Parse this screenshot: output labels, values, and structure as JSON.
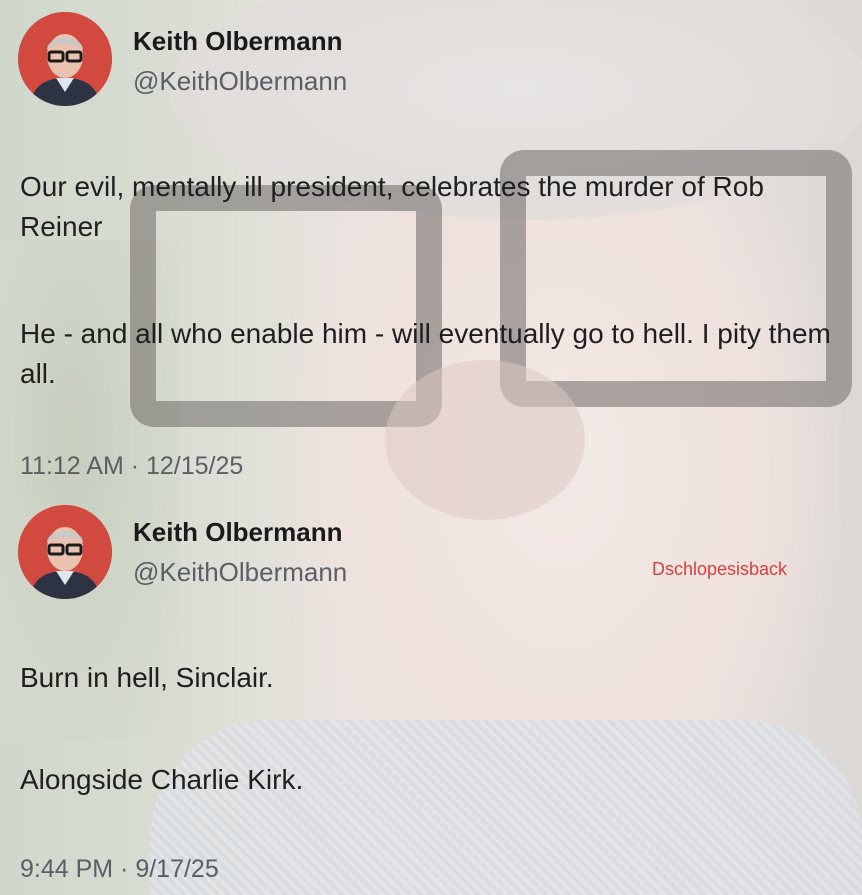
{
  "watermark": "Dschlopesisback",
  "tweets": [
    {
      "author_name": "Keith Olbermann",
      "author_handle": "@KeithOlbermann",
      "paragraphs": [
        "Our evil, mentally ill president, celebrates the murder of Rob Reiner",
        "He - and all who enable him - will eventually go to hell. I pity them all."
      ],
      "timestamp": "11:12 AM · 12/15/25"
    },
    {
      "author_name": "Keith Olbermann",
      "author_handle": "@KeithOlbermann",
      "paragraphs": [
        "Burn in hell, Sinclair.",
        "Alongside Charlie Kirk."
      ],
      "timestamp": "9:44 PM · 9/17/25"
    }
  ],
  "colors": {
    "avatar_bg": "#d24a3f",
    "watermark": "#d8413f",
    "handle": "#5a5f66"
  }
}
